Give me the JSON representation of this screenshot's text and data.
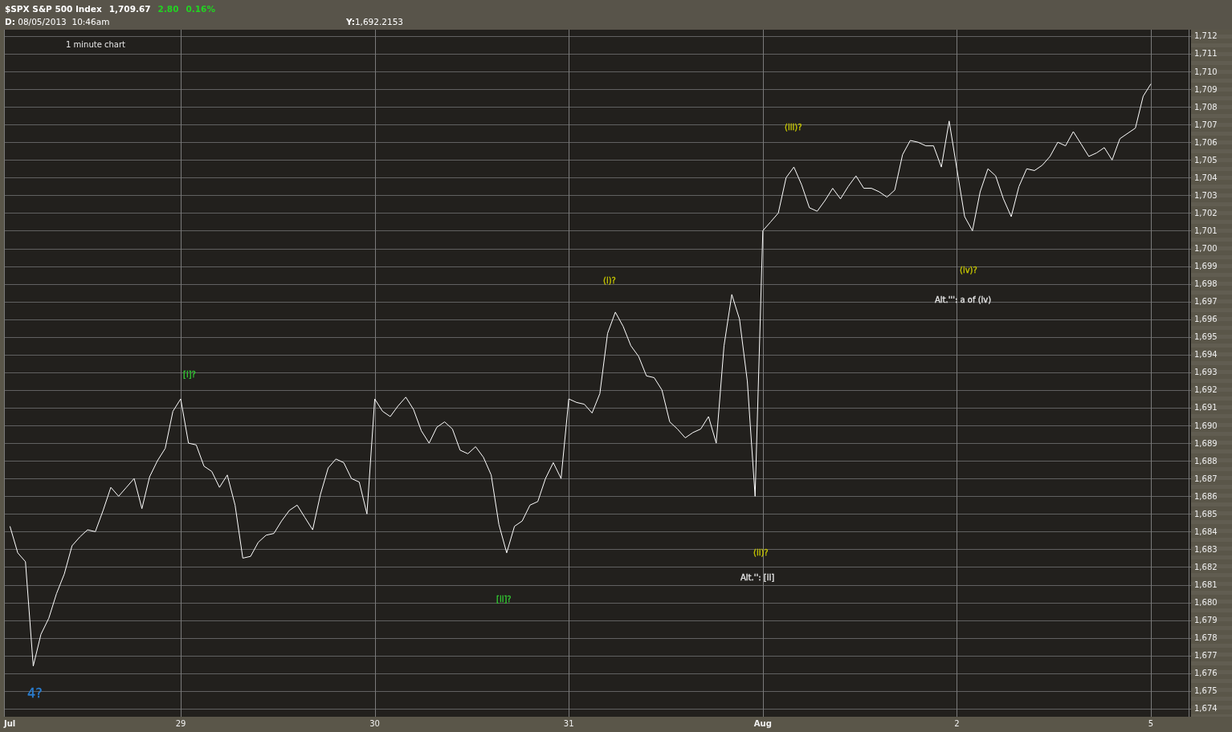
{
  "quote": {
    "title": "$SPX S&P 500 Index",
    "last": "1,709.67",
    "change": "2.80",
    "change_percent": "0.16%",
    "date": "**D:** 08/05/2013  10:46am",
    "cursor_value": "**Y:**1,692.2153"
  },
  "chart": {
    "chart_data": {
      "type": "line",
      "title": "1 minute chart",
      "grid": true,
      "categories": [
        "Jul",
        null,
        null,
        null,
        null,
        null,
        null,
        null,
        null,
        null,
        null,
        null,
        null,
        null,
        null,
        null,
        null,
        null,
        null,
        null,
        null,
        null,
        "29",
        null,
        null,
        null,
        null,
        null,
        null,
        null,
        null,
        null,
        null,
        null,
        null,
        null,
        null,
        null,
        null,
        null,
        null,
        null,
        null,
        null,
        null,
        null,
        null,
        "30",
        null,
        null,
        null,
        null,
        null,
        null,
        null,
        null,
        null,
        null,
        null,
        null,
        null,
        null,
        null,
        null,
        null,
        null,
        null,
        null,
        null,
        null,
        null,
        null,
        "31",
        null,
        null,
        null,
        null,
        null,
        null,
        null,
        null,
        null,
        null,
        null,
        null,
        null,
        null,
        null,
        null,
        null,
        null,
        null,
        null,
        null,
        null,
        null,
        null,
        "Aug",
        null,
        null,
        null,
        null,
        null,
        null,
        null,
        null,
        null,
        null,
        null,
        null,
        null,
        null,
        null,
        null,
        null,
        null,
        null,
        null,
        null,
        null,
        null,
        null,
        "2",
        null,
        null,
        null,
        null,
        null,
        null,
        null,
        null,
        null,
        null,
        null,
        null,
        null,
        null,
        null,
        null,
        null,
        null,
        null,
        null,
        null,
        null,
        null,
        null,
        "5"
      ],
      "series": [
        {
          "color": "#ffffff",
          "values": [
            1684.3,
            1682.8,
            1682.3,
            1676.4,
            1678.2,
            1679.1,
            1680.5,
            1681.6,
            1683.2,
            1683.7,
            1684.1,
            1684.0,
            1685.2,
            1686.5,
            1686.0,
            1686.5,
            1687.0,
            1685.3,
            1687.1,
            1688.0,
            1688.7,
            1690.8,
            1691.5,
            1689.0,
            1688.9,
            1687.7,
            1687.4,
            1686.5,
            1687.2,
            1685.5,
            1682.5,
            1682.6,
            1683.4,
            1683.8,
            1683.9,
            1684.6,
            1685.2,
            1685.5,
            1684.8,
            1684.1,
            1686.1,
            1687.6,
            1688.1,
            1687.9,
            1687.0,
            1686.8,
            1685.0,
            1691.5,
            1690.8,
            1690.5,
            1691.1,
            1691.6,
            1690.9,
            1689.7,
            1689.0,
            1689.9,
            1690.2,
            1689.8,
            1688.6,
            1688.4,
            1688.8,
            1688.2,
            1687.2,
            1684.4,
            1682.8,
            1684.3,
            1684.6,
            1685.5,
            1685.7,
            1687.0,
            1687.9,
            1687.0,
            1691.5,
            1691.3,
            1691.2,
            1690.7,
            1691.8,
            1695.2,
            1696.4,
            1695.6,
            1694.5,
            1693.9,
            1692.8,
            1692.7,
            1692.0,
            1690.2,
            1689.8,
            1689.3,
            1689.6,
            1689.8,
            1690.5,
            1689.0,
            1694.5,
            1697.4,
            1696.0,
            1692.5,
            1686.0,
            1701.0,
            1701.5,
            1702.0,
            1704.0,
            1704.6,
            1703.6,
            1702.3,
            1702.1,
            1702.7,
            1703.4,
            1702.8,
            1703.5,
            1704.1,
            1703.4,
            1703.4,
            1703.2,
            1702.9,
            1703.3,
            1705.3,
            1706.1,
            1706.0,
            1705.8,
            1705.8,
            1704.6,
            1707.2,
            1704.5,
            1701.8,
            1701.0,
            1703.2,
            1704.5,
            1704.1,
            1702.8,
            1701.8,
            1703.5,
            1704.5,
            1704.4,
            1704.7,
            1705.2,
            1706.0,
            1705.8,
            1706.6,
            1705.9,
            1705.2,
            1705.4,
            1705.7,
            1705.0,
            1706.2,
            1706.5,
            1706.8,
            1708.6,
            1709.3
          ]
        }
      ],
      "ylim": [
        1673.54,
        1712.36
      ],
      "yticks": [
        {
          "value": 1712,
          "label": "1,712"
        },
        {
          "value": 1711,
          "label": "1,711"
        },
        {
          "value": 1710,
          "label": "1,710"
        },
        {
          "value": 1709,
          "label": "1,709"
        },
        {
          "value": 1708,
          "label": "1,708"
        },
        {
          "value": 1707,
          "label": "1,707"
        },
        {
          "value": 1706,
          "label": "1,706"
        },
        {
          "value": 1705,
          "label": "1,705"
        },
        {
          "value": 1704,
          "label": "1,704"
        },
        {
          "value": 1703,
          "label": "1,703"
        },
        {
          "value": 1702,
          "label": "1,702"
        },
        {
          "value": 1701,
          "label": "1,701"
        },
        {
          "value": 1700,
          "label": "1,700"
        },
        {
          "value": 1699,
          "label": "1,699"
        },
        {
          "value": 1698,
          "label": "1,698"
        },
        {
          "value": 1697,
          "label": "1,697"
        },
        {
          "value": 1696,
          "label": "1,696"
        },
        {
          "value": 1695,
          "label": "1,695"
        },
        {
          "value": 1694,
          "label": "1,694"
        },
        {
          "value": 1693,
          "label": "1,693"
        },
        {
          "value": 1692,
          "label": "1,692"
        },
        {
          "value": 1691,
          "label": "1,691"
        },
        {
          "value": 1690,
          "label": "1,690"
        },
        {
          "value": 1689,
          "label": "1,689"
        },
        {
          "value": 1688,
          "label": "1,688"
        },
        {
          "value": 1687,
          "label": "1,687"
        },
        {
          "value": 1686,
          "label": "1,686"
        },
        {
          "value": 1685,
          "label": "1,685"
        },
        {
          "value": 1684,
          "label": "1,684"
        },
        {
          "value": 1683,
          "label": "1,683"
        },
        {
          "value": 1682,
          "label": "1,682"
        },
        {
          "value": 1681,
          "label": "1,681"
        },
        {
          "value": 1680,
          "label": "1,680"
        },
        {
          "value": 1679,
          "label": "1,679"
        },
        {
          "value": 1678,
          "label": "1,678"
        },
        {
          "value": 1677,
          "label": "1,677"
        },
        {
          "value": 1676,
          "label": "1,676"
        },
        {
          "value": 1675,
          "label": "1,675"
        },
        {
          "value": 1674,
          "label": "1,674"
        }
      ]
    },
    "wave_labels": [
      {
        "text": "4?",
        "color": "#2a7fd4",
        "kind": "major"
      },
      {
        "text": "[i]?",
        "color": "#33cc33",
        "kind": "wave"
      },
      {
        "text": "[ii]?",
        "color": "#33cc33",
        "kind": "wave"
      },
      {
        "text": "(i)?",
        "color": "#c8c800",
        "kind": "wave"
      },
      {
        "text": "Alt.'': [ii]",
        "color": "#e6e6e6",
        "kind": "note"
      },
      {
        "text": "(ii)?",
        "color": "#c8c800",
        "kind": "wave"
      },
      {
        "text": "(iii)?",
        "color": "#c8c800",
        "kind": "wave"
      },
      {
        "text": "Alt.''': a of (iv)",
        "color": "#e6e6e6",
        "kind": "note"
      },
      {
        "text": "(iv)?",
        "color": "#c8c800",
        "kind": "wave"
      }
    ]
  }
}
